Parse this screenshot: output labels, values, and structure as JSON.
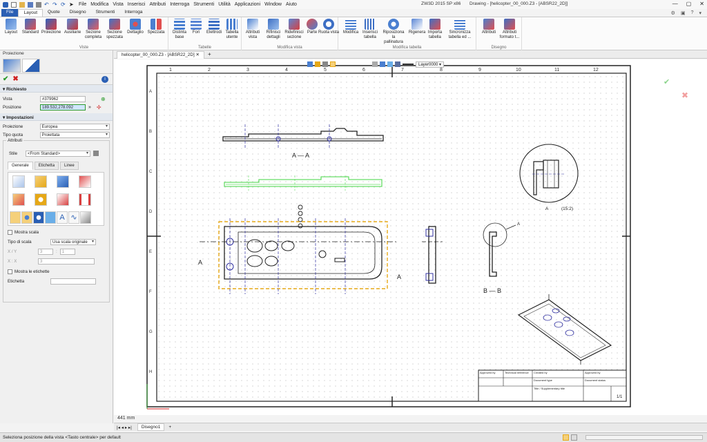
{
  "titlebar": {
    "menu": [
      "File",
      "Modifica",
      "Vista",
      "Inserisci",
      "Attributi",
      "Interroga",
      "Strumenti",
      "Utilità",
      "Applicazioni",
      "Window",
      "Aiuto"
    ],
    "app": "ZW3D 2015 SP x86",
    "document": "Drawing - [helicopter_00_000.Z3 - [ABSR22_2D]]"
  },
  "ribbon_tabs": [
    "File",
    "Layout",
    "Quote",
    "Disegno",
    "Strumenti",
    "Interroga"
  ],
  "ribbon_tabs_active": "Layout",
  "ribbon": {
    "groups": [
      {
        "label": "Viste",
        "buttons": [
          "Layout",
          "Standard",
          "Proiezione",
          "Ausiliarie",
          "Sezione completa",
          "Sezione spezzata",
          "Dettaglio",
          "Spezzata"
        ]
      },
      {
        "label": "Tabelle",
        "buttons": [
          "Distinta base",
          "Fori",
          "Elettrodi",
          "Tabella utente"
        ]
      },
      {
        "label": "Modifica vista",
        "buttons": [
          "Attributi vista",
          "Rifinisci dettagli",
          "Ridefinisci sezione",
          "Parte",
          "Ruota vista"
        ]
      },
      {
        "label": "Modifica tabella",
        "buttons": [
          "Modifica",
          "Inserisci tabella",
          "Riposiziona la pallinatura",
          "Rigenera",
          "Importa tabella",
          "Sincronizza tabella ed ..."
        ]
      },
      {
        "label": "Disegno",
        "buttons": [
          "Attributi",
          "Attributi formato t..."
        ]
      }
    ]
  },
  "left_panel": {
    "title": "Proiezione",
    "sections": {
      "required": "Richiesto",
      "settings": "Impostazioni",
      "attributes": "Attributi"
    },
    "fields": {
      "vista_label": "Vista",
      "vista_value": "#379962",
      "posizione_label": "Posizione",
      "posizione_value": "189.532,278.092",
      "proiezione_label": "Proiezione",
      "proiezione_value": "Europea",
      "tipo_quota_label": "Tipo quota",
      "tipo_quota_value": "Proiettata",
      "stile_label": "Stile",
      "stile_value": "<From Standard>"
    },
    "subtabs": [
      "Generale",
      "Etichetta",
      "Linee"
    ],
    "subtabs_active": "Generale",
    "options": {
      "mostra_scala": "Mostra scala",
      "tipo_scala_label": "Tipo di scala",
      "tipo_scala_value": "Usa scala originale",
      "xy_label": "X / Y",
      "xy_val1": "3",
      "xy_val2": "1",
      "xx_label": "X : X",
      "xx_val": "3",
      "mostra_etichette": "Mostra le etichette",
      "etichetta_label": "Etichetta"
    }
  },
  "doc_tab": "helicopter_00_000.Z3 - [ABSR22_2D]",
  "canvas_toolbar": {
    "layer": "Layer0000"
  },
  "drawing": {
    "top_numbers": [
      "1",
      "2",
      "3",
      "4",
      "5",
      "6",
      "7",
      "8",
      "9",
      "10",
      "11",
      "12"
    ],
    "side_letters": [
      "A",
      "B",
      "C",
      "D",
      "E",
      "F",
      "G",
      "H"
    ],
    "labels": {
      "section_aa": "A — A",
      "section_bb": "B — B",
      "detail": "A",
      "detail_scale": "(15:2)",
      "cut_left": "A",
      "cut_right": "A",
      "detail_leader": "A"
    },
    "title_block": {
      "c1": "Approved by",
      "c2": "Technical reference",
      "c3": "Created by",
      "c4": "Approved by",
      "c5": "Document type",
      "c6": "Document status",
      "c7": "Title / Supplementary title",
      "sheet": "1/1"
    }
  },
  "sheet_tab": "Disegno1",
  "measurement": "441 mm",
  "status": "Seleziona posizione della vista <Tasto centrale> per default",
  "colors": {
    "accent": "#2a5fb4",
    "view_highlight": "#e6a817",
    "preview_green": "#66dd66",
    "cut_blue": "#3030a0"
  }
}
